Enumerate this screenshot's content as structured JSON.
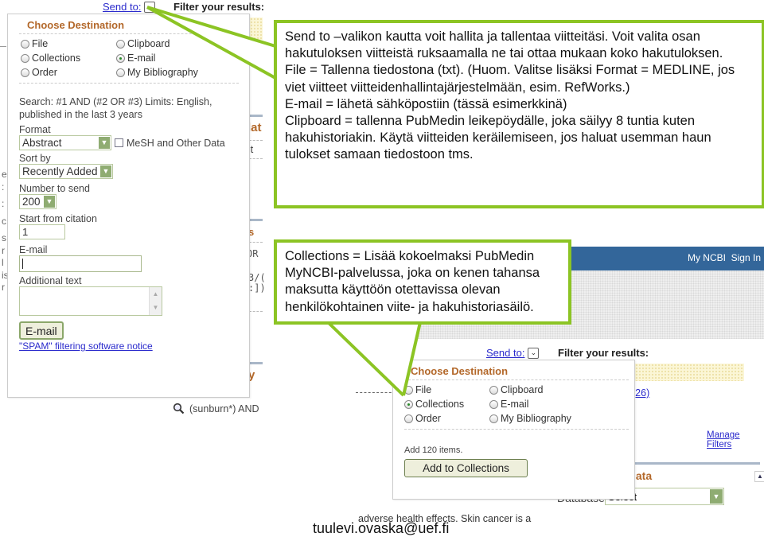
{
  "top_popup": {
    "send_to_label": "Send to:",
    "send_to_icon": "chevron-down-icon",
    "filter_label": "Filter your results:",
    "heading": "Choose Destination",
    "destinations": [
      {
        "label": "File",
        "selected": false
      },
      {
        "label": "Clipboard",
        "selected": false
      },
      {
        "label": "Collections",
        "selected": false
      },
      {
        "label": "E-mail",
        "selected": true
      },
      {
        "label": "Order",
        "selected": false
      },
      {
        "label": "My Bibliography",
        "selected": false
      }
    ],
    "search_summary": "Search: #1 AND (#2 OR #3) Limits: English, published in the last 3 years",
    "format_label": "Format",
    "format_value": "Abstract",
    "mesh_label": "MeSH and Other Data",
    "mesh_checked": false,
    "sort_label": "Sort by",
    "sort_value": "Recently Added",
    "number_label": "Number to send",
    "number_value": "200",
    "start_label": "Start from citation",
    "start_value": "1",
    "email_label": "E-mail",
    "email_value": "",
    "additional_label": "Additional text",
    "additional_value": "",
    "email_button": "E-mail",
    "spam_link": "\"SPAM\" filtering software notice"
  },
  "background": {
    "frag_title_1": "lat",
    "frag_text_1": ":t",
    "frag_title_2": "s",
    "frag_mono_1": "OR",
    "frag_mono_2": "3/(",
    "frag_mono_3": ":])",
    "frag_title_3": "y",
    "search_history_text": "(sunburn*) AND",
    "left_edge_chars": [
      "e",
      ":",
      ":",
      "c",
      "s",
      "r",
      "l",
      "is",
      "r"
    ],
    "ncbi_links": [
      "My NCBI",
      "Sign In"
    ],
    "count_link": "(26)",
    "manage_filters": "Manage Filters",
    "bottom_title": "lata",
    "database_label": "Database:",
    "database_value": "Select",
    "abstract_fragment": "adverse health effects. Skin cancer is a"
  },
  "bottom_popup": {
    "send_to_label": "Send to:",
    "filter_label": "Filter your results:",
    "heading": "Choose Destination",
    "destinations": [
      {
        "label": "File",
        "selected": false
      },
      {
        "label": "Clipboard",
        "selected": false
      },
      {
        "label": "Collections",
        "selected": true
      },
      {
        "label": "E-mail",
        "selected": false
      },
      {
        "label": "Order",
        "selected": false
      },
      {
        "label": "My Bibliography",
        "selected": false
      }
    ],
    "add_text": "Add 120 items.",
    "add_button": "Add to Collections"
  },
  "callouts": {
    "send_to": [
      "Send to –valikon kautta voit hallita ja tallentaa viitteitäsi. Voit valita osan hakutuloksen viitteistä ruksaamalla ne tai ottaa mukaan koko hakutuloksen.",
      "File = Tallenna tiedostona (txt). (Huom. Valitse lisäksi Format = MEDLINE, jos viet viitteet viitteidenhallintajärjestelmään, esim. RefWorks.)",
      "E-mail = lähetä sähköpostiin (tässä esimerkkinä)",
      "Clipboard = tallenna PubMedin leikepöydälle, joka säilyy 8 tuntia kuten hakuhistoriakin. Käytä viitteiden keräilemiseen, jos haluat usemman haun tulokset samaan tiedostoon tms."
    ],
    "collections": [
      "Collections = Lisää kokoelmaksi PubMedin MyNCBI-palvelussa, joka on kenen tahansa maksutta käyttöön otettavissa olevan henkilökohtainen viite- ja hakuhistoriasäilö."
    ]
  },
  "footer": {
    "email": "tuulevi.ovaska@uef.fi"
  },
  "colors": {
    "callout_border": "#8cc424",
    "heading": "#b3682a",
    "ncbi_bar": "#33669a",
    "link": "#2a2acc"
  }
}
